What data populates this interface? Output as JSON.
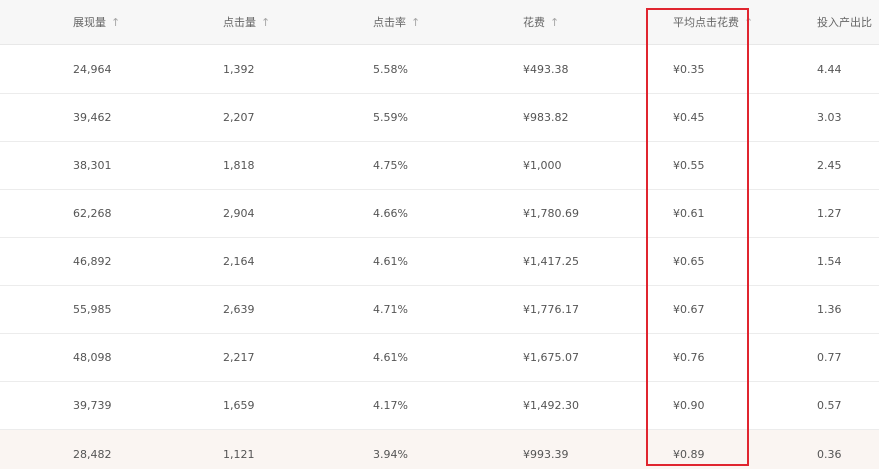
{
  "columns": [
    {
      "label": "展现量",
      "sort_icon": "arrow-up-icon"
    },
    {
      "label": "点击量",
      "sort_icon": "arrow-up-icon"
    },
    {
      "label": "点击率",
      "sort_icon": "arrow-up-icon"
    },
    {
      "label": "花费",
      "sort_icon": "arrow-up-icon"
    },
    {
      "label": "平均点击花费",
      "sort_icon": "arrow-up-icon"
    },
    {
      "label": "投入产出比",
      "sort_icon": "arrow-up-icon"
    }
  ],
  "sort_glyph": "↑",
  "rows": [
    [
      "24,964",
      "1,392",
      "5.58%",
      "¥493.38",
      "¥0.35",
      "4.44"
    ],
    [
      "39,462",
      "2,207",
      "5.59%",
      "¥983.82",
      "¥0.45",
      "3.03"
    ],
    [
      "38,301",
      "1,818",
      "4.75%",
      "¥1,000",
      "¥0.55",
      "2.45"
    ],
    [
      "62,268",
      "2,904",
      "4.66%",
      "¥1,780.69",
      "¥0.61",
      "1.27"
    ],
    [
      "46,892",
      "2,164",
      "4.61%",
      "¥1,417.25",
      "¥0.65",
      "1.54"
    ],
    [
      "55,985",
      "2,639",
      "4.71%",
      "¥1,776.17",
      "¥0.67",
      "1.36"
    ],
    [
      "48,098",
      "2,217",
      "4.61%",
      "¥1,675.07",
      "¥0.76",
      "0.77"
    ],
    [
      "39,739",
      "1,659",
      "4.17%",
      "¥1,492.30",
      "¥0.90",
      "0.57"
    ],
    [
      "28,482",
      "1,121",
      "3.94%",
      "¥993.39",
      "¥0.89",
      "0.36"
    ]
  ],
  "highlighted_row_index": 8,
  "highlighted_column_index": 4,
  "colors": {
    "highlight_border": "#e0252f",
    "header_bg": "#f7f7f7",
    "highlighted_row_bg": "#faf5f2"
  }
}
